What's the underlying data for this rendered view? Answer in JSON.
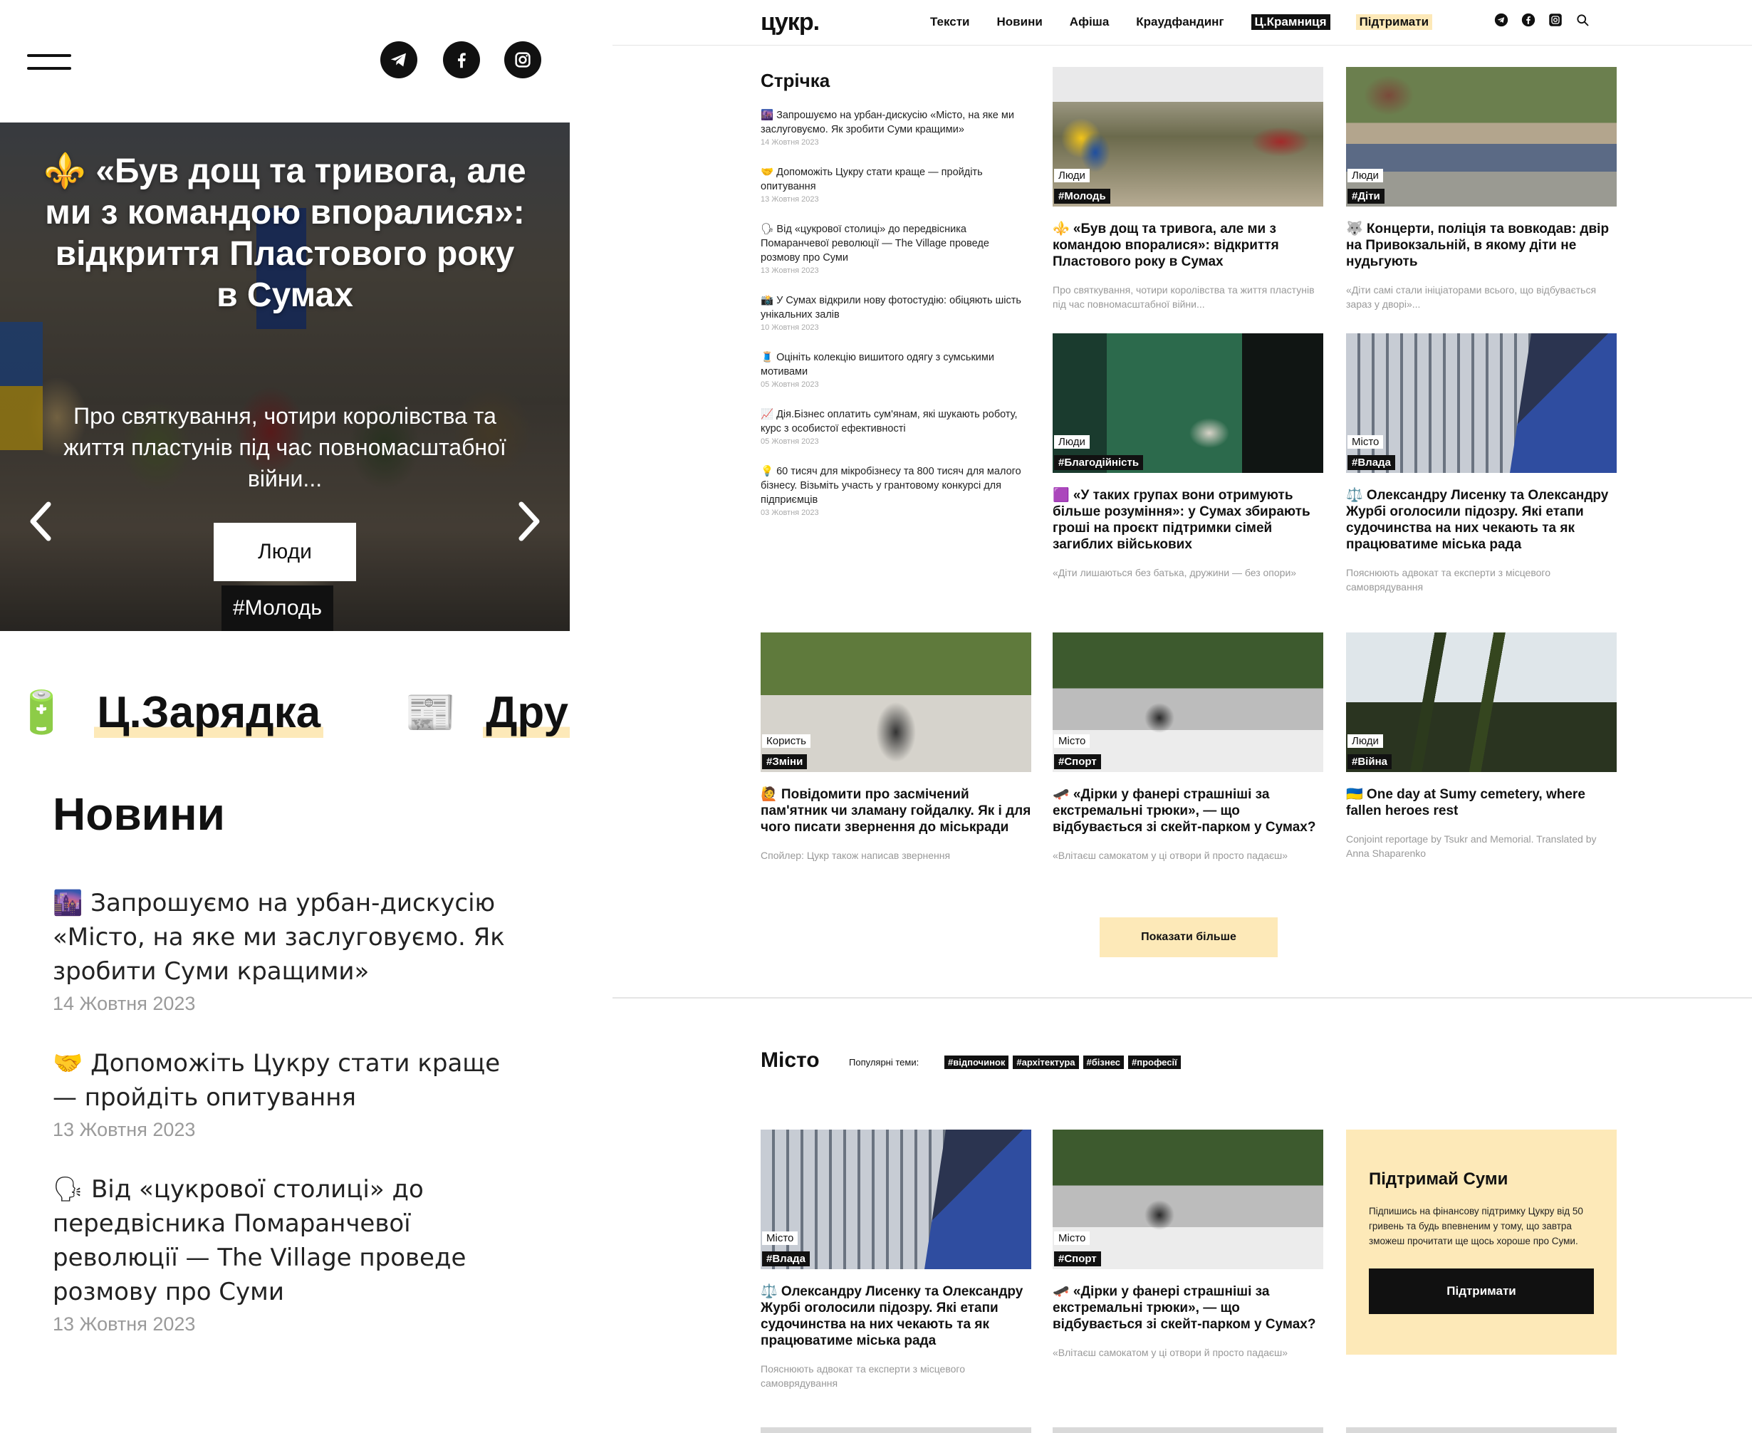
{
  "mobile": {
    "menu_icon": "hamburger-icon",
    "social": [
      "telegram-icon",
      "facebook-icon",
      "instagram-icon"
    ],
    "hero": {
      "emoji": "⚜️",
      "title": "«Був дощ та тривога, але ми з командою впоралися»: відкриття Пластового року в Сумах",
      "subtitle": "Про святкування, чотири королівства та життя пластунів під час повномасштабної війни...",
      "category": "Люди",
      "tag": "#Молодь"
    },
    "sections": [
      {
        "icon": "🔋",
        "label": "Ц.Зарядка"
      },
      {
        "icon": "📰",
        "label": "Дру"
      }
    ],
    "news_title": "Новини",
    "news": [
      {
        "title": "🌆 Запрошуємо на урбан-дискусію «Місто, на яке ми заслуговуємо. Як зробити Суми кращими»",
        "date": "14 Жовтня 2023"
      },
      {
        "title": "🤝 Допоможіть Цукру стати краще — пройдіть опитування",
        "date": "13 Жовтня 2023"
      },
      {
        "title": "🗣 Від «цукрової столиці» до передвісника Помаранчевої революції — The Village проведе розмову про Суми",
        "date": "13 Жовтня 2023"
      }
    ]
  },
  "desktop": {
    "logo": "цукр.",
    "menu": [
      "Тексти",
      "Новини",
      "Афіша",
      "Краудфандинг",
      "Ц.Крамниця",
      "Підтримати"
    ],
    "nav_icons": [
      "telegram-icon",
      "facebook-icon",
      "instagram-icon",
      "search-icon"
    ],
    "feed_title": "Стрічка",
    "feed": [
      {
        "title": "🌆 Запрошуємо на урбан-дискусію «Місто, на яке ми заслуговуємо. Як зробити Суми кращими»",
        "date": "14 Жовтня 2023"
      },
      {
        "title": "🤝 Допоможіть Цукру стати краще — пройдіть опитування",
        "date": "13 Жовтня 2023"
      },
      {
        "title": "🗣 Від «цукрової столиці» до передвісника Помаранчевої революції — The Village проведе розмову про Суми",
        "date": "13 Жовтня 2023"
      },
      {
        "title": "📸 У Сумах відкрили нову фотостудію: обіцяють шість унікальних залів",
        "date": "10 Жовтня 2023"
      },
      {
        "title": "🧵 Оцініть колекцію вишитого одягу з сумськими мотивами",
        "date": "05 Жовтня 2023"
      },
      {
        "title": "📈 Дія.Бізнес оплатить сум'янам, які шукають роботу, курс з особистої ефективності",
        "date": "05 Жовтня 2023"
      },
      {
        "title": "💡 60 тисяч для мікробізнесу та 800 тисяч для малого бізнесу. Візьміть участь у грантовому конкурсі для підприємців",
        "date": "03 Жовтня 2023"
      }
    ],
    "cards": [
      {
        "category": "Люди",
        "tag": "#Молодь",
        "title": "⚜️ «Був дощ та тривога, але ми з командою впоралися»: відкриття Пластового року в Сумах",
        "lead": "Про святкування, чотири королівства та життя пластунів під час повномасштабної війни..."
      },
      {
        "category": "Люди",
        "tag": "#Діти",
        "title": "🐺 Концерти, поліція та вовкодав: двір на Привокзальній, в якому діти не нудьгують",
        "lead": "«Діти самі стали ініціаторами всього, що відбувається зараз у дворі»..."
      },
      {
        "category": "Люди",
        "tag": "#Благодійність",
        "title": "🟪 «У таких групах вони отримують більше розуміння»: у Сумах збирають гроші на проєкт підтримки сімей загиблих військових",
        "lead": "«Діти лишаються без батька, дружини — без опори»"
      },
      {
        "category": "Місто",
        "tag": "#Влада",
        "title": "⚖️ Олександру Лисенку та Олександру Журбі оголосили підозру. Які етапи судочинства на них чекають та як працюватиме міська рада",
        "lead": "Пояснюють адвокат та експерти з місцевого самоврядування"
      },
      {
        "category": "Користь",
        "tag": "#Зміни",
        "title": "🙋 Повідомити про засмічений пам'ятник чи зламану гойдалку. Як і для чого писати звернення до міськради",
        "lead": "Спойлер: Цукр також написав звернення"
      },
      {
        "category": "Місто",
        "tag": "#Спорт",
        "title": "🛹 «Дірки у фанері страшніші за екстремальні трюки», — що відбувається зі скейт-парком у Сумах?",
        "lead": "«Влітаєш самокатом у ці отвори й просто падаєш»"
      },
      {
        "category": "Люди",
        "tag": "#Війна",
        "title": "🇺🇦 One day at Sumy cemetery, where fallen heroes rest",
        "lead": "Conjoint reportage by Tsukr and Memorial. Translated by Anna Shaparenko"
      }
    ],
    "show_more": "Показати більше",
    "city": {
      "title": "Місто",
      "popular_label": "Популярні теми:",
      "topics": [
        "#відпочинок",
        "#архітектура",
        "#бізнес",
        "#професії"
      ],
      "cards": [
        {
          "category": "Місто",
          "tag": "#Влада",
          "title": "⚖️ Олександру Лисенку та Олександру Журбі оголосили підозру. Які етапи судочинства на них чекають та як працюватиме міська рада",
          "lead": "Пояснюють адвокат та експерти з місцевого самоврядування"
        },
        {
          "category": "Місто",
          "tag": "#Спорт",
          "title": "🛹 «Дірки у фанері страшніші за екстремальні трюки», — що відбувається зі скейт-парком у Сумах?",
          "lead": "«Влітаєш самокатом у ці отвори й просто падаєш»"
        }
      ]
    },
    "support": {
      "title": "Підтримай Суми",
      "text": "Підпишись на фінансову підтримку Цукру від 50 гривень та будь впевненим у тому, що завтра зможеш прочитати ще щось хороше про Суми.",
      "button": "Підтримати"
    }
  },
  "colors": {
    "accent_yellow": "#fde9b8",
    "black": "#111111",
    "muted": "#999999"
  }
}
